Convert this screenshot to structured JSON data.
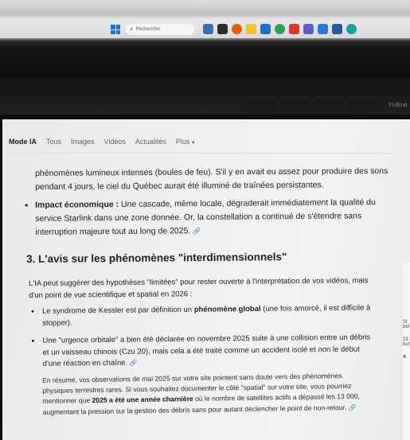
{
  "taskbar": {
    "search_placeholder": "Rechercher",
    "pinned_icons": [
      "photos-icon",
      "terminal-icon",
      "firefox-icon",
      "files-icon",
      "store-icon",
      "chrome-icon",
      "app-icon",
      "teams-icon",
      "cloud-icon",
      "word-icon",
      "edge-icon"
    ],
    "fn_key_label": "Fn/End"
  },
  "search_tabs": [
    {
      "label": "Mode IA",
      "active": true
    },
    {
      "label": "Tous",
      "active": false
    },
    {
      "label": "Images",
      "active": false
    },
    {
      "label": "Vidéos",
      "active": false
    },
    {
      "label": "Actualités",
      "active": false
    },
    {
      "label": "Plus",
      "active": false
    }
  ],
  "content": {
    "para1": "phénomènes lumineux intenses (boules de feu). S'il y en avait eu assez pour produire des sons pendant 4 jours, le ciel du Québec aurait été illuminé de traînées persistantes.",
    "bullet_economic": {
      "label": "Impact économique :",
      "text": " Une cascade, même locale, dégraderait immédiatement la qualité du service Starlink dans une zone donnée. Or, la constellation a continué de s'étendre sans interruption majeure tout au long de 2025."
    },
    "heading": "3. L'avis sur les phénomènes \"interdimensionnels\"",
    "intro": "L'IA peut suggérer des hypothèses \"limitées\" pour rester ouverte à l'interprétation de vos vidéos, mais d'un point de vue scientifique et spatial en 2026 :",
    "item1_a": "Le syndrome de Kessler est par définition un ",
    "item1_bold": "phénomène global",
    "item1_b": " (une fois amorcé, il est difficile à stopper).",
    "item2": "Une \"urgence orbitale\" a bien été déclarée en novembre 2025 suite à une collision entre un débris et un vaisseau chinois (Czu 20), mais cela a été traité comme un accident isolé et non le début d'une réaction en chaîne.",
    "summary_a": "En résumé, vos observations de mai 2025 sur votre site pointent sans doute vers des phénomènes physiques terrestres rares. Si vous souhaitez documenter le côté \"spatial\" sur votre site, vous pourriez mentionner que ",
    "summary_bold": "2025 a été une année charnière",
    "summary_b": " où le nombre de satellites actifs a dépassé les 13 000, augmentant la pression sur la gestion des débris sans pour autant déclencher le point de non-retour."
  },
  "right_panel": {
    "top_text": "St bel",
    "date_text": "23 bur",
    "mark": "A"
  },
  "colors": {
    "windows_blue": "#1d73d1",
    "text_dark": "#202124",
    "tab_grey": "#5f6368"
  }
}
